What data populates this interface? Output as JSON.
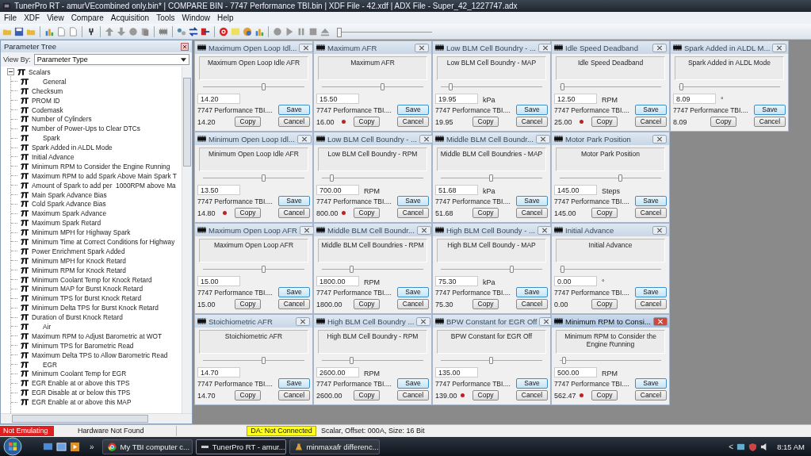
{
  "window": {
    "title": "TunerPro RT - amurVEcombined only.bin* | COMPARE BIN - 7747 Performance TBI.bin | XDF File - 42.xdf | ADX File - Super_42_1227747.adx"
  },
  "menu": [
    "File",
    "XDF",
    "View",
    "Compare",
    "Acquisition",
    "Tools",
    "Window",
    "Help"
  ],
  "toolbar": {
    "slider": {
      "level": 0
    }
  },
  "parameter_tree": {
    "title": "Parameter Tree",
    "view_by_label": "View By:",
    "view_by_value": "Parameter Type",
    "root": {
      "label": "Scalars",
      "expanded": true,
      "children": [
        {
          "label": "General",
          "kind": "category"
        },
        {
          "label": "Checksum",
          "kind": "item"
        },
        {
          "label": "PROM ID",
          "kind": "item"
        },
        {
          "label": "Codemask",
          "kind": "item"
        },
        {
          "label": "Number of Cylinders",
          "kind": "item"
        },
        {
          "label": "Number of Power-Ups to Clear DTCs",
          "kind": "item"
        },
        {
          "label": "Spark",
          "kind": "category"
        },
        {
          "label": "Spark Added in ALDL Mode",
          "kind": "item"
        },
        {
          "label": "Initial Advance",
          "kind": "item"
        },
        {
          "label": "Minimum RPM to Consider the Engine Running",
          "kind": "item"
        },
        {
          "label": "Maximum RPM to add Spark Above Main Spark T",
          "kind": "item"
        },
        {
          "label": "Amount of Spark to add per  1000RPM above Ma",
          "kind": "item"
        },
        {
          "label": "Main Spark Advance Bias",
          "kind": "item"
        },
        {
          "label": "Cold Spark Advance Bias",
          "kind": "item"
        },
        {
          "label": "Maximum Spark Advance",
          "kind": "item"
        },
        {
          "label": "Maximum Spark Retard",
          "kind": "item"
        },
        {
          "label": "Minimum MPH for Highway Spark",
          "kind": "item"
        },
        {
          "label": "Minimum Time at Correct Conditions for Highway",
          "kind": "item"
        },
        {
          "label": "Power Enrichment Spark Added",
          "kind": "item"
        },
        {
          "label": "Minimum MPH for Knock Retard",
          "kind": "item"
        },
        {
          "label": "Minimum RPM for Knock Retard",
          "kind": "item"
        },
        {
          "label": "Minimum Coolant Temp for Knock Retard",
          "kind": "item"
        },
        {
          "label": "Minimum MAP for Burst Knock Retard",
          "kind": "item"
        },
        {
          "label": "Minimum TPS for Burst Knock Retard",
          "kind": "item"
        },
        {
          "label": "Minimum Delta TPS for Burst Knock Retard",
          "kind": "item"
        },
        {
          "label": "Duration of Burst Knock Retard",
          "kind": "item"
        },
        {
          "label": "Air",
          "kind": "category"
        },
        {
          "label": "Maximum RPM to Adjust Barometric at WOT",
          "kind": "item"
        },
        {
          "label": "Minimum TPS for Barometric Read",
          "kind": "item"
        },
        {
          "label": "Maximum Delta TPS to Allow Barometric Read",
          "kind": "item"
        },
        {
          "label": "EGR",
          "kind": "category"
        },
        {
          "label": "Minimum Coolant Temp for EGR",
          "kind": "item"
        },
        {
          "label": "EGR Enable at or above this TPS",
          "kind": "item"
        },
        {
          "label": "EGR Disable at or below this TPS",
          "kind": "item"
        },
        {
          "label": "EGR Enable at or above this MAP",
          "kind": "item"
        }
      ]
    }
  },
  "window_rows": [
    {
      "windows": [
        {
          "title": "Maximum Open Loop Idl...",
          "description": "Maximum Open Loop Idle AFR",
          "level": 0.6,
          "value": "14.20",
          "bin_label": "7747 Performance TBI....",
          "compare_value": "14.20",
          "differs": false,
          "active": false,
          "save": "Save",
          "copy": "Copy",
          "cancel": "Cancel"
        },
        {
          "title": "Maximum AFR",
          "description": "Maximum AFR",
          "level": 0.6,
          "value": "15.50",
          "bin_label": "7747 Performance TBI....",
          "compare_value": "16.00",
          "differs": true,
          "active": false,
          "save": "Save",
          "copy": "Copy",
          "cancel": "Cancel"
        },
        {
          "title": "Low BLM Cell Boundry - ...",
          "description": "Low BLM Cell Boundry - MAP",
          "level": 0.1,
          "value": "19.95",
          "unit": "kPa",
          "bin_label": "7747 Performance TBI....",
          "compare_value": "19.95",
          "differs": false,
          "active": false,
          "save": "Save",
          "copy": "Copy",
          "cancel": "Cancel"
        },
        {
          "title": "Idle Speed Deadband",
          "description": "Idle Speed Deadband",
          "level": 0.03,
          "value": "12.50",
          "unit": "RPM",
          "bin_label": "7747 Performance TBI....",
          "compare_value": "25.00",
          "differs": true,
          "active": false,
          "save": "Save",
          "copy": "Copy",
          "cancel": "Cancel"
        },
        {
          "title": "Spark Added in ALDL M...",
          "description": "Spark Added in ALDL Mode",
          "level": 0.03,
          "value": "8.09",
          "unit": "°",
          "bin_label": "7747 Performance TBI....",
          "compare_value": "8.09",
          "differs": false,
          "active": false,
          "save": "Save",
          "copy": "Copy",
          "cancel": "Cancel"
        }
      ]
    },
    {
      "windows": [
        {
          "title": "Minimum Open Loop Idl...",
          "description": "Minimum Open Loop Idle AFR",
          "level": 0.6,
          "value": "13.50",
          "bin_label": "7747 Performance TBI....",
          "compare_value": "14.80",
          "differs": true,
          "active": false,
          "save": "Save",
          "copy": "Copy",
          "cancel": "Cancel"
        },
        {
          "title": "Low BLM Cell Boundry - ...",
          "description": "Low BLM Cell Boundry - RPM",
          "level": 0.1,
          "value": "700.00",
          "unit": "RPM",
          "bin_label": "7747 Performance TBI....",
          "compare_value": "800.00",
          "differs": true,
          "active": false,
          "save": "Save",
          "copy": "Copy",
          "cancel": "Cancel"
        },
        {
          "title": "Middle BLM Cell Boundr...",
          "description": "Middle BLM Cell Boundries - MAP",
          "level": 0.5,
          "value": "51.68",
          "unit": "kPa",
          "bin_label": "7747 Performance TBI....",
          "compare_value": "51.68",
          "differs": false,
          "active": false,
          "save": "Save",
          "copy": "Copy",
          "cancel": "Cancel"
        },
        {
          "title": "Motor Park Position",
          "description": "Motor Park Position",
          "level": 0.6,
          "value": "145.00",
          "unit": "Steps",
          "bin_label": "7747 Performance TBI....",
          "compare_value": "145.00",
          "differs": false,
          "active": false,
          "save": "Save",
          "copy": "Copy",
          "cancel": "Cancel"
        }
      ]
    },
    {
      "windows": [
        {
          "title": "Maximum Open Loop AFR",
          "description": "Maximum Open Loop AFR",
          "level": 0.6,
          "value": "15.00",
          "bin_label": "7747 Performance TBI....",
          "compare_value": "15.00",
          "differs": false,
          "active": false,
          "save": "Save",
          "copy": "Copy",
          "cancel": "Cancel"
        },
        {
          "title": "Middle BLM Cell Boundr...",
          "description": "Middle BLM Cell Boundries - RPM",
          "level": 0.3,
          "value": "1800.00",
          "unit": "RPM",
          "bin_label": "7747 Performance TBI....",
          "compare_value": "1800.00",
          "differs": false,
          "active": false,
          "save": "Save",
          "copy": "Copy",
          "cancel": "Cancel"
        },
        {
          "title": "High BLM Cell Boundy - ...",
          "description": "High BLM Cell Boundy - MAP",
          "level": 0.7,
          "value": "75.30",
          "unit": "kPa",
          "bin_label": "7747 Performance TBI....",
          "compare_value": "75.30",
          "differs": false,
          "active": false,
          "save": "Save",
          "copy": "Copy",
          "cancel": "Cancel"
        },
        {
          "title": "Initial Advance",
          "description": "Initial Advance",
          "level": 0.03,
          "value": "0.00",
          "unit": "°",
          "bin_label": "7747 Performance TBI....",
          "compare_value": "0.00",
          "differs": false,
          "active": false,
          "save": "Save",
          "copy": "Copy",
          "cancel": "Cancel"
        }
      ]
    },
    {
      "windows": [
        {
          "title": "Stoichiometric AFR",
          "description": "Stoichiometric AFR",
          "level": 0.6,
          "value": "14.70",
          "bin_label": "7747 Performance TBI....",
          "compare_value": "14.70",
          "differs": false,
          "active": false,
          "save": "Save",
          "copy": "Copy",
          "cancel": "Cancel"
        },
        {
          "title": "High BLM Cell Boundry ...",
          "description": "High BLM Cell Boundry - RPM",
          "level": 0.3,
          "value": "2600.00",
          "unit": "RPM",
          "bin_label": "7747 Performance TBI....",
          "compare_value": "2600.00",
          "differs": false,
          "active": false,
          "save": "Save",
          "copy": "Copy",
          "cancel": "Cancel"
        },
        {
          "title": "BPW Constant for EGR Off",
          "description": "BPW Constant for EGR Off",
          "level": 0.5,
          "value": "135.00",
          "bin_label": "7747 Performance TBI....",
          "compare_value": "139.00",
          "differs": true,
          "active": false,
          "save": "Save",
          "copy": "Copy",
          "cancel": "Cancel"
        },
        {
          "title": "Minimum RPM to Consi...",
          "description": "Minimum RPM to Consider the Engine Running",
          "level": 0.05,
          "value": "500.00",
          "unit": "RPM",
          "bin_label": "7747 Performance TBI....",
          "compare_value": "562.47",
          "differs": true,
          "active": true,
          "save": "Save",
          "copy": "Copy",
          "cancel": "Cancel"
        }
      ]
    }
  ],
  "status_bar": {
    "emulation": "Not Emulating",
    "hardware": "Hardware Not Found",
    "da": "DA: Not Connected",
    "info": "Scalar, Offset: 000A,  Size: 16 Bit"
  },
  "taskbar": {
    "more": "»",
    "tasks": [
      {
        "label": "My TBI computer c...",
        "selected": false
      },
      {
        "label": "TunerPro RT - amur...",
        "selected": true
      },
      {
        "label": "minmaxafr differenc...",
        "selected": false
      }
    ],
    "tray_toggle": "<",
    "time": "8:15 AM"
  }
}
